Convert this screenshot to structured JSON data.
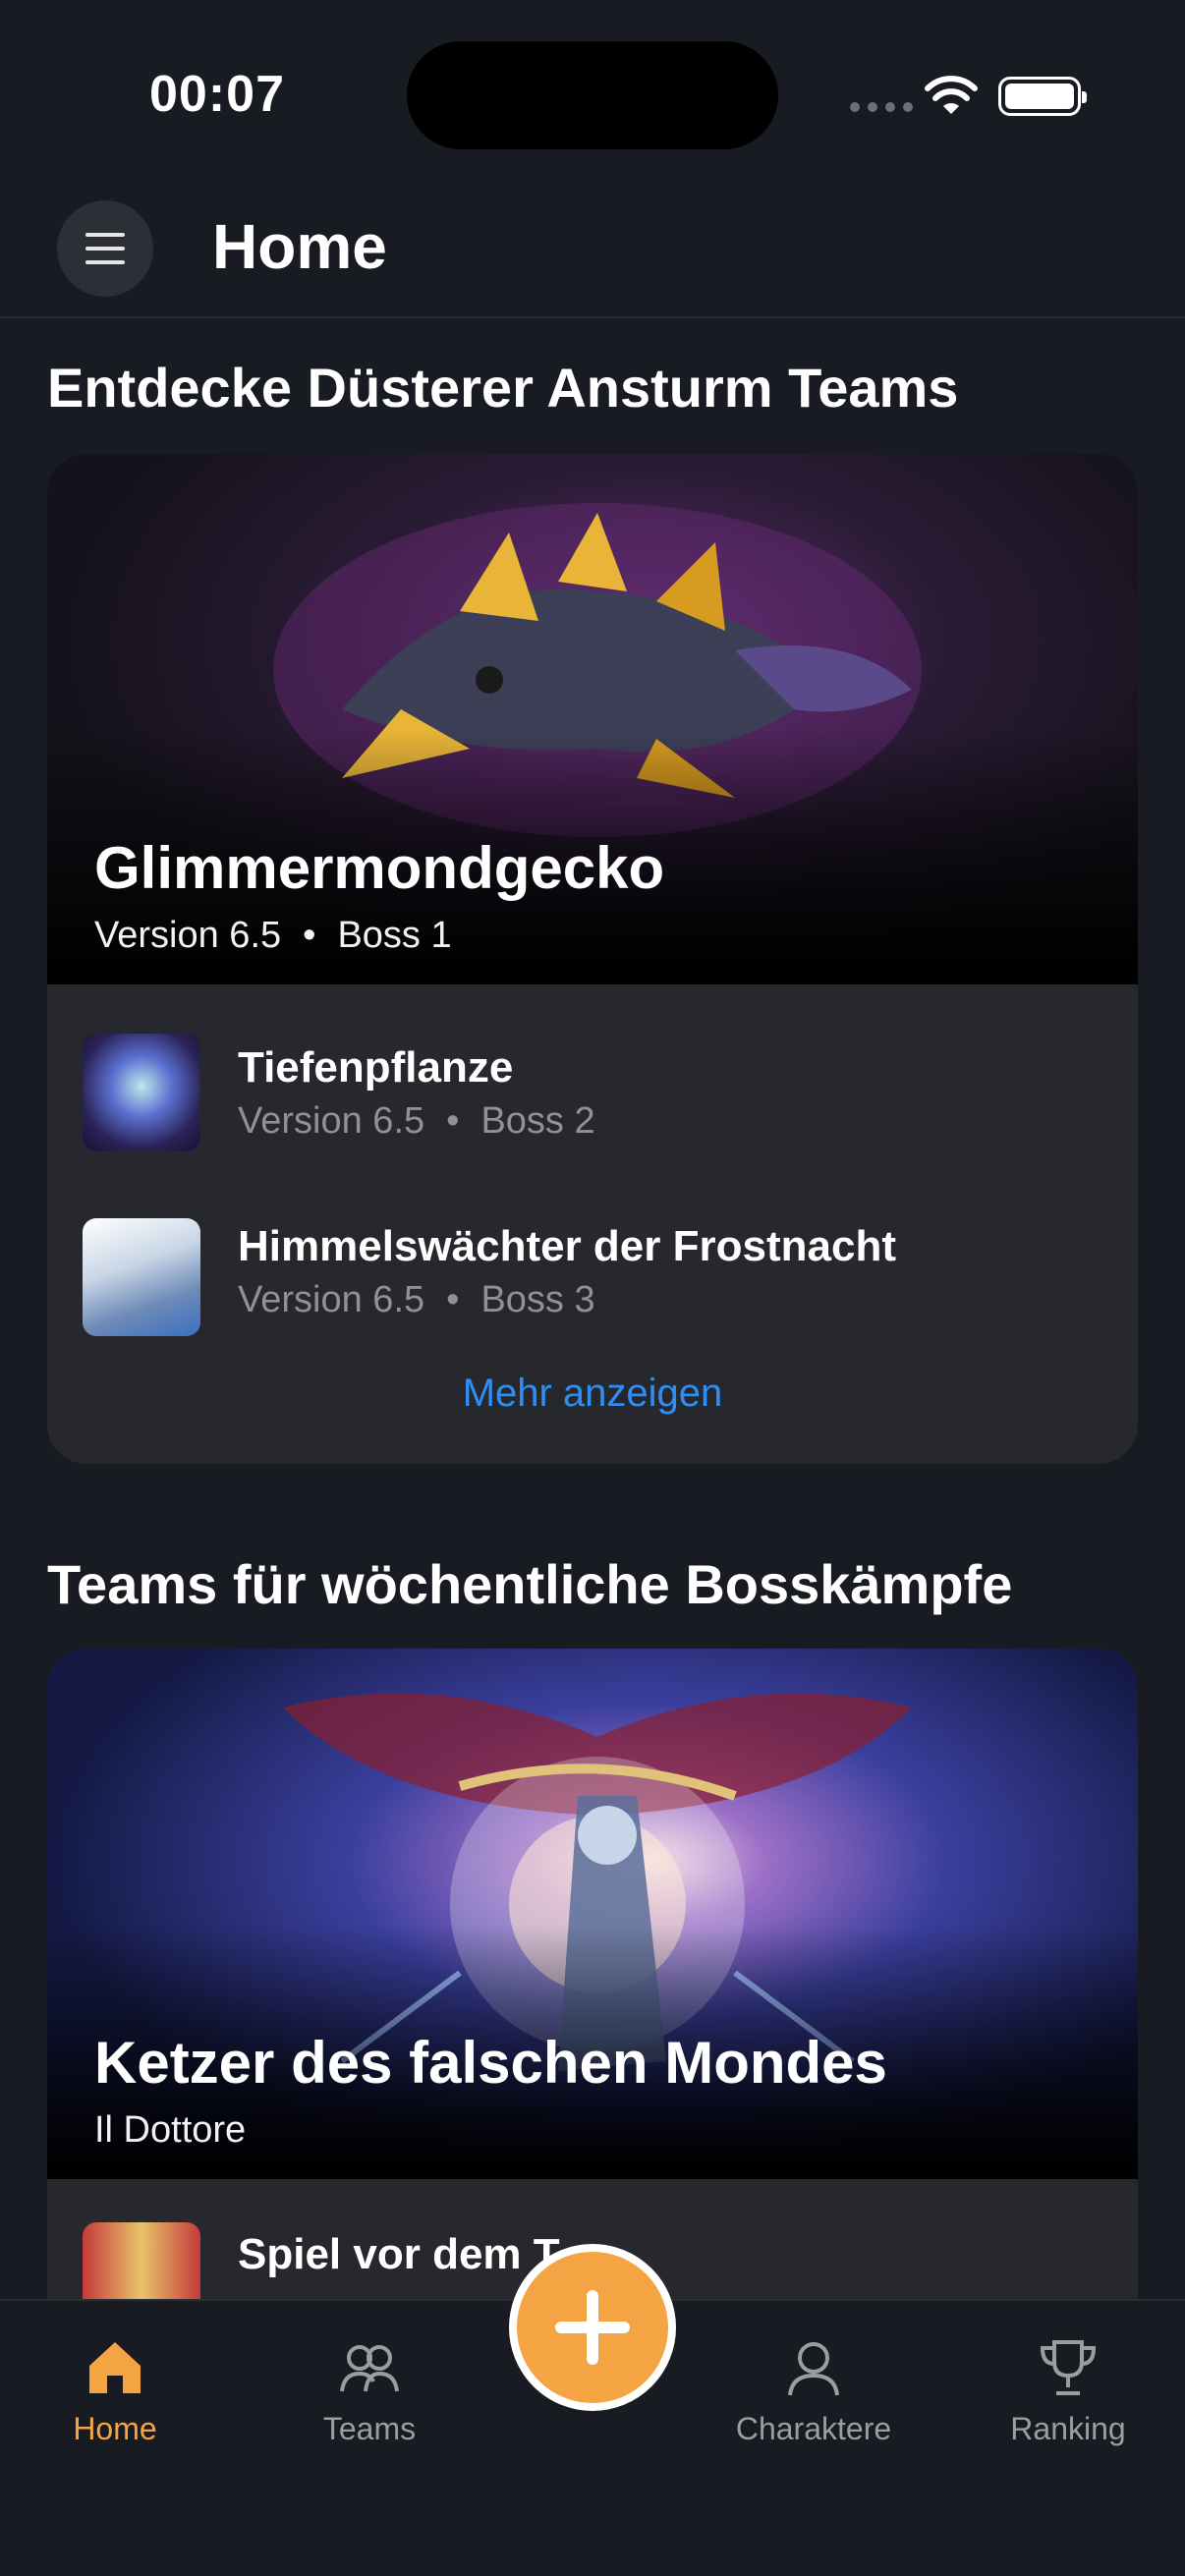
{
  "status": {
    "time": "00:07"
  },
  "header": {
    "title": "Home"
  },
  "section1": {
    "title": "Entdecke Düsterer Ansturm Teams",
    "hero": {
      "title": "Glimmermondgecko",
      "version": "Version 6.5",
      "boss": "Boss 1"
    },
    "items": [
      {
        "title": "Tiefenpflanze",
        "version": "Version 6.5",
        "boss": "Boss 2"
      },
      {
        "title": "Himmelswächter der Frostnacht",
        "version": "Version 6.5",
        "boss": "Boss 3"
      }
    ],
    "more": "Mehr anzeigen"
  },
  "section2": {
    "title": "Teams für wöchentliche Bosskämpfe",
    "hero": {
      "title": "Ketzer des falschen Mondes",
      "subtitle": "Il Dottore"
    },
    "items": [
      {
        "title": "Spiel vor dem T"
      }
    ]
  },
  "nav": {
    "home": "Home",
    "teams": "Teams",
    "characters": "Charaktere",
    "ranking": "Ranking"
  },
  "colors": {
    "accent": "#f4a443",
    "link": "#2f8ef2",
    "background": "#181b22",
    "card": "#26282d"
  }
}
